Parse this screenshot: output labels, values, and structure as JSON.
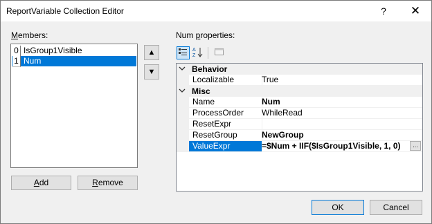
{
  "window": {
    "title": "ReportVariable Collection Editor",
    "help_glyph": "?",
    "close_glyph": "✕"
  },
  "members": {
    "label_ul": "M",
    "label_rest": "embers:",
    "items": [
      {
        "index": "0",
        "name": "IsGroup1Visible",
        "selected": false
      },
      {
        "index": "1",
        "name": "Num",
        "selected": true
      }
    ],
    "up_glyph": "▲",
    "down_glyph": "▼",
    "add_ul": "A",
    "add_rest": "dd",
    "remove_ul": "R",
    "remove_rest": "emove"
  },
  "properties": {
    "label_pre": "Num ",
    "label_ul": "p",
    "label_rest": "roperties:",
    "categories": [
      {
        "name": "Behavior",
        "rows": [
          {
            "name": "Localizable",
            "value": "True",
            "bold": false
          }
        ]
      },
      {
        "name": "Misc",
        "rows": [
          {
            "name": "Name",
            "value": "Num",
            "bold": true
          },
          {
            "name": "ProcessOrder",
            "value": "WhileRead",
            "bold": false
          },
          {
            "name": "ResetExpr",
            "value": "",
            "bold": false
          },
          {
            "name": "ResetGroup",
            "value": "NewGroup",
            "bold": true
          },
          {
            "name": "ValueExpr",
            "value": "=$Num + IIF($IsGroup1Visible, 1, 0)",
            "bold": true,
            "selected": true
          }
        ]
      }
    ],
    "ellipsis": "..."
  },
  "footer": {
    "ok": "OK",
    "cancel": "Cancel"
  },
  "colors": {
    "selection": "#0078d7",
    "background": "#f0f0f0"
  }
}
